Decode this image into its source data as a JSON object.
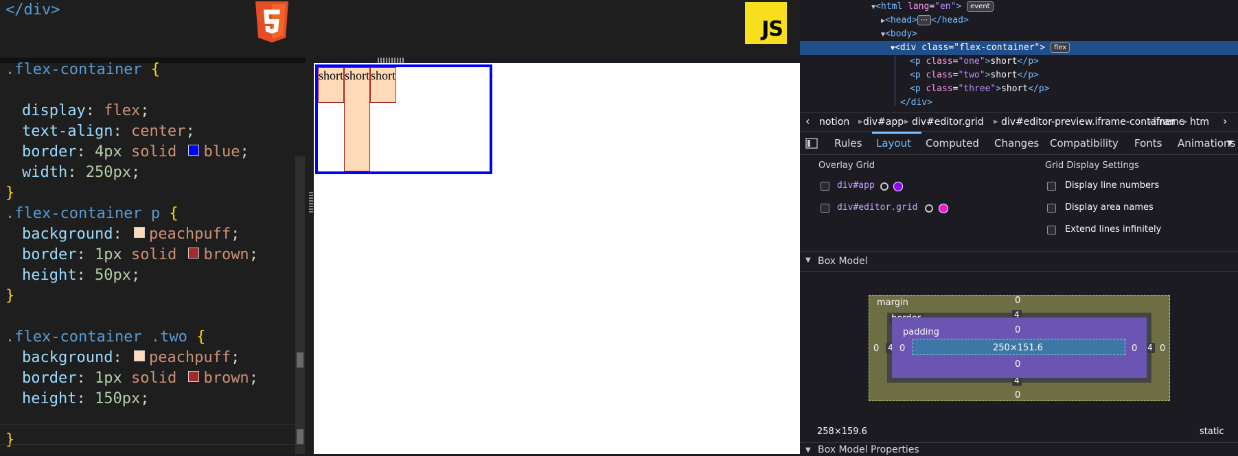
{
  "html_pane": {
    "closing_tag": "</div>"
  },
  "css": {
    "lines": [
      {
        "kind": "sel",
        "text": ".flex-container {"
      },
      {
        "kind": "blank"
      },
      {
        "kind": "decl",
        "prop": "display",
        "value": "flex"
      },
      {
        "kind": "decl",
        "prop": "text-align",
        "value": "center"
      },
      {
        "kind": "decl-color",
        "prop": "border",
        "pre": "4px solid",
        "swatch": "#0000ff",
        "value": "blue"
      },
      {
        "kind": "decl",
        "prop": "width",
        "value": "250px"
      },
      {
        "kind": "close",
        "text": "}"
      },
      {
        "kind": "sel",
        "text": ".flex-container p {"
      },
      {
        "kind": "decl-color",
        "prop": "background",
        "pre": "",
        "swatch": "#ffdab9",
        "value": "peachpuff"
      },
      {
        "kind": "decl-color",
        "prop": "border",
        "pre": "1px solid",
        "swatch": "#a52a2a",
        "value": "brown"
      },
      {
        "kind": "decl",
        "prop": "height",
        "value": "50px"
      },
      {
        "kind": "close",
        "text": "}"
      },
      {
        "kind": "blank"
      },
      {
        "kind": "sel",
        "text": ".flex-container .two {"
      },
      {
        "kind": "decl-color",
        "prop": "background",
        "pre": "",
        "swatch": "#ffdab9",
        "value": "peachpuff"
      },
      {
        "kind": "decl-color",
        "prop": "border",
        "pre": "1px solid",
        "swatch": "#a52a2a",
        "value": "brown"
      },
      {
        "kind": "decl",
        "prop": "height",
        "value": "150px"
      },
      {
        "kind": "blank"
      },
      {
        "kind": "close",
        "text": "}"
      }
    ]
  },
  "badges": {
    "html5": "5",
    "js": "JS"
  },
  "preview": {
    "items": [
      "short",
      "short",
      "short"
    ]
  },
  "devtools": {
    "tree": {
      "html_line": {
        "tag": "html",
        "attr": "lang",
        "value": "\"en\"",
        "pill": "event"
      },
      "head_line": {
        "open": "<head>",
        "close": "</head>"
      },
      "body_line": "<body>",
      "div_line": {
        "tag": "div",
        "attr": "class",
        "value": "\"flex-container\"",
        "pill": "flex"
      },
      "children": [
        {
          "cls": "\"one\"",
          "text": "short"
        },
        {
          "cls": "\"two\"",
          "text": "short"
        },
        {
          "cls": "\"three\"",
          "text": "short"
        }
      ],
      "div_close": "</div>"
    },
    "breadcrumbs": [
      "notion",
      "div#app",
      "div#editor.grid",
      "div#editor-preview.iframe-container",
      "iframe",
      "htm"
    ],
    "tabs": [
      "Rules",
      "Layout",
      "Computed",
      "Changes",
      "Compatibility",
      "Fonts",
      "Animations"
    ],
    "active_tab": "Layout",
    "overlay_grid": {
      "title": "Overlay Grid",
      "items": [
        {
          "label": "div#app",
          "color": "#9400ff"
        },
        {
          "label": "div#editor.grid",
          "color": "#e61cd2"
        }
      ]
    },
    "grid_settings": {
      "title": "Grid Display Settings",
      "options": [
        "Display line numbers",
        "Display area names",
        "Extend lines infinitely"
      ]
    },
    "box_model": {
      "title": "Box Model",
      "margin_label": "margin",
      "border_label": "border",
      "padding_label": "padding",
      "margin": {
        "top": "0",
        "right": "0",
        "bottom": "0",
        "left": "0"
      },
      "border": {
        "top": "4",
        "right": "4",
        "bottom": "4",
        "left": "4"
      },
      "padding": {
        "top": "0",
        "right": "0",
        "bottom": "0",
        "left": "0"
      },
      "content": "250×151.6",
      "outer_size": "258×159.6",
      "position": "static"
    },
    "box_model_props_title": "Box Model Properties"
  }
}
